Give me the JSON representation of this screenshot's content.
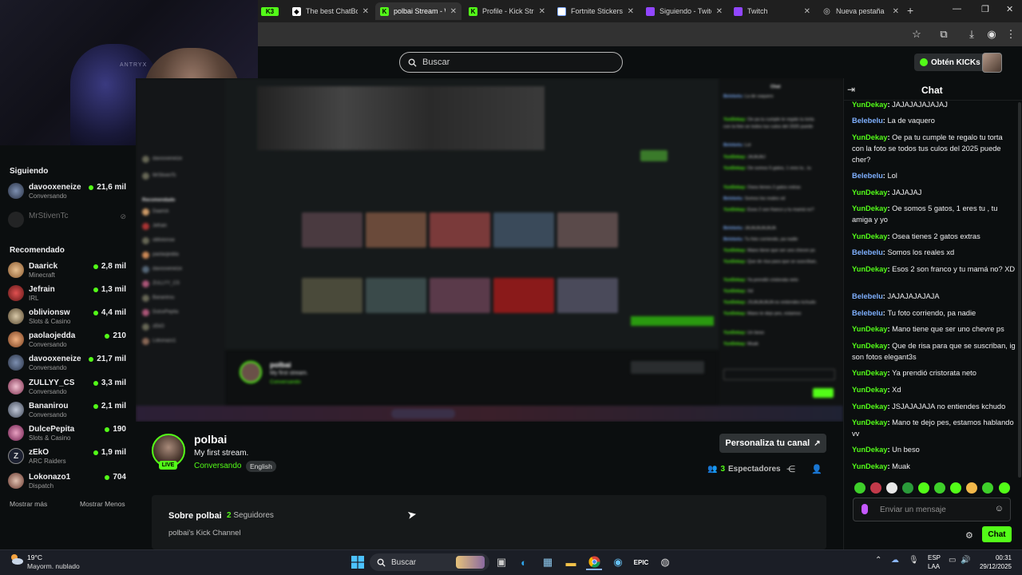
{
  "browser": {
    "tabs": [
      {
        "label": "The best ChatBot",
        "active": false
      },
      {
        "label": "polbai Stream - W",
        "active": true
      },
      {
        "label": "Profile - Kick Stre",
        "active": false
      },
      {
        "label": "Fortnite Stickers -",
        "active": false
      },
      {
        "label": "Siguiendo - Twitch",
        "active": false
      },
      {
        "label": "Twitch",
        "active": false
      },
      {
        "label": "Nueva pestaña",
        "active": false
      }
    ],
    "new_tab": "+",
    "partial_tab_logo": "K3"
  },
  "webcam": {
    "brand_text": "ANTRYX"
  },
  "kick_header": {
    "search_placeholder": "Buscar",
    "get_kicks": "Obtén KICKs"
  },
  "sidebar": {
    "following_title": "Siguiendo",
    "following": [
      {
        "name": "davooxeneize",
        "category": "Conversando",
        "viewers": "21,6 mil",
        "online": true
      },
      {
        "name": "MrStivenTc",
        "category": "",
        "viewers": "",
        "online": false
      }
    ],
    "recommended_title": "Recomendado",
    "recommended": [
      {
        "name": "Daarick",
        "category": "Minecraft",
        "viewers": "2,8 mil"
      },
      {
        "name": "Jefrain",
        "category": "IRL",
        "viewers": "1,3 mil"
      },
      {
        "name": "oblivionsw",
        "category": "Slots & Casino",
        "viewers": "4,4 mil"
      },
      {
        "name": "paolaojedda",
        "category": "Conversando",
        "viewers": "210"
      },
      {
        "name": "davooxeneize",
        "category": "Conversando",
        "viewers": "21,7 mil"
      },
      {
        "name": "ZULLYY_CS",
        "category": "Conversando",
        "viewers": "3,3 mil"
      },
      {
        "name": "Bananirou",
        "category": "Conversando",
        "viewers": "2,1 mil"
      },
      {
        "name": "DulcePepita",
        "category": "Slots & Casino",
        "viewers": "190"
      },
      {
        "name": "zEkO",
        "category": "ARC Raiders",
        "viewers": "1,9 mil"
      },
      {
        "name": "Lokonazo1",
        "category": "Dispatch",
        "viewers": "704"
      }
    ],
    "show_more": "Mostrar más",
    "show_less": "Mostrar Menos"
  },
  "channel": {
    "name": "polbai",
    "live": "LIVE",
    "title": "My first stream.",
    "category": "Conversando",
    "language": "English",
    "customize": "Personaliza tu canal",
    "viewers_count": "3",
    "viewers_label": "Espectadores"
  },
  "about": {
    "title": "Sobre polbai",
    "followers_count": "2",
    "followers_label": "Seguidores",
    "description": "polbai's Kick Channel"
  },
  "chat": {
    "title": "Chat",
    "messages": [
      {
        "user": "YunDekay",
        "color": "#53fc18",
        "text": "JAJAJAJAJAJAJ"
      },
      {
        "user": "Belebelu",
        "color": "#7fb0ff",
        "text": "La de vaquero"
      },
      {
        "user": "YunDekay",
        "color": "#53fc18",
        "text": "Oe pa tu cumple te regalo tu torta con la foto se todos tus culos del 2025 puede cher?"
      },
      {
        "user": "Belebelu",
        "color": "#7fb0ff",
        "text": "Lol"
      },
      {
        "user": "YunDekay",
        "color": "#53fc18",
        "text": "JAJAJAJ"
      },
      {
        "user": "YunDekay",
        "color": "#53fc18",
        "text": "Oe somos 5 gatos, 1 eres tu , tu amiga y yo"
      },
      {
        "user": "YunDekay",
        "color": "#53fc18",
        "text": "Osea tienes 2 gatos extras"
      },
      {
        "user": "Belebelu",
        "color": "#7fb0ff",
        "text": "Somos los reales xd"
      },
      {
        "user": "YunDekay",
        "color": "#53fc18",
        "text": "Esos 2 son franco y tu mamá no? XD"
      },
      {
        "user": "Belebelu",
        "color": "#7fb0ff",
        "text": "JAJAJAJAJAJA"
      },
      {
        "user": "Belebelu",
        "color": "#7fb0ff",
        "text": "Tu foto corriendo, pa nadie"
      },
      {
        "user": "YunDekay",
        "color": "#53fc18",
        "text": "Mano tiene que ser uno chevre ps"
      },
      {
        "user": "YunDekay",
        "color": "#53fc18",
        "text": "Que de risa para que se suscriban, ig son fotos elegant3s"
      },
      {
        "user": "YunDekay",
        "color": "#53fc18",
        "text": "Ya prendió cristorata neto"
      },
      {
        "user": "YunDekay",
        "color": "#53fc18",
        "text": "Xd"
      },
      {
        "user": "YunDekay",
        "color": "#53fc18",
        "text": "JSJAJAJAJA no entiendes kchudo"
      },
      {
        "user": "YunDekay",
        "color": "#53fc18",
        "text": "Mano te dejo pes, estamos hablando vv"
      },
      {
        "user": "YunDekay",
        "color": "#53fc18",
        "text": "Un beso"
      },
      {
        "user": "YunDekay",
        "color": "#53fc18",
        "text": "Muak"
      }
    ],
    "input_placeholder": "Enviar un mensaje",
    "send": "Chat"
  },
  "taskbar": {
    "weather_temp": "19°C",
    "weather_desc": "Mayorm. nublado",
    "search": "Buscar",
    "lang_1": "ESP",
    "lang_2": "LAA",
    "time": "00:31",
    "date": "29/12/2025"
  },
  "colors": {
    "kick_green": "#53fc18",
    "background": "#0b0e0f",
    "chat_blue_user": "#7fb0ff"
  }
}
